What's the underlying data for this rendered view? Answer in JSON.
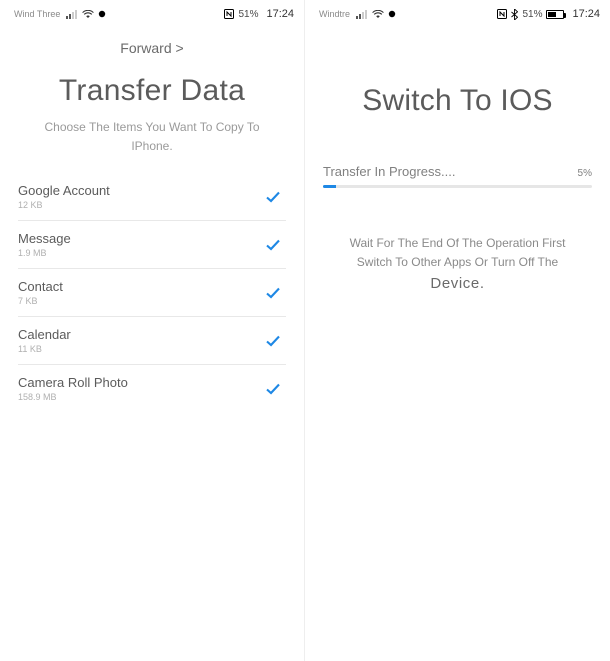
{
  "left": {
    "statusbar": {
      "carrier": "Wind Three",
      "battery_text": "51%",
      "battery_pct": 51,
      "time": "17:24"
    },
    "forward_label": "Forward >",
    "title": "Transfer Data",
    "subtitle": "Choose The Items You Want To Copy To IPhone.",
    "items": [
      {
        "label": "Google Account",
        "size": "12 KB",
        "checked": true
      },
      {
        "label": "Message",
        "size": "1.9 MB",
        "checked": true
      },
      {
        "label": "Contact",
        "size": "7 KB",
        "checked": true
      },
      {
        "label": "Calendar",
        "size": "11 KB",
        "checked": true
      },
      {
        "label": "Camera Roll Photo",
        "size": "158.9 MB",
        "checked": true
      }
    ]
  },
  "right": {
    "statusbar": {
      "carrier": "Windtre",
      "battery_text": "51%",
      "battery_pct": 51,
      "time": "17:24"
    },
    "title": "Switch To IOS",
    "progress": {
      "label": "Transfer In Progress....",
      "percent_text": "5%",
      "percent": 5
    },
    "message_line1": "Wait For The End Of The Operation First",
    "message_line2": "Switch To Other Apps Or Turn Off The",
    "message_device": "Device."
  }
}
